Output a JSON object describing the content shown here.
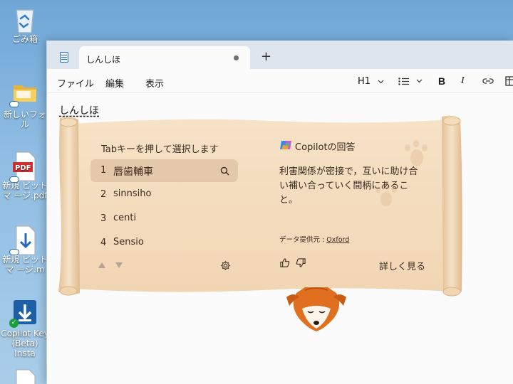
{
  "desktop": {
    "icons": [
      {
        "label": "ごみ箱",
        "icon": "recycle-bin-icon"
      },
      {
        "label": "新しいフォル",
        "icon": "folder-icon"
      },
      {
        "label": "新規 ビットマ ージ.pdf",
        "icon": "pdf-icon"
      },
      {
        "label": "新規 ビットマ ージ.m",
        "icon": "download-file-icon"
      },
      {
        "label": "Copilot Key (Beta) Insta",
        "icon": "installer-icon"
      }
    ]
  },
  "window": {
    "tab_title": "しんしほ",
    "new_tab": "+",
    "menu": [
      "ファイル",
      "編集",
      "表示"
    ],
    "toolbar": {
      "heading": "H1"
    },
    "editor_text": "しんしほ"
  },
  "ime_popup": {
    "title": "Tabキーを押して選択します",
    "candidates": [
      {
        "num": "1",
        "text": "唇歯輔車",
        "selected": true
      },
      {
        "num": "2",
        "text": "sinnsiho",
        "selected": false
      },
      {
        "num": "3",
        "text": "centi",
        "selected": false
      },
      {
        "num": "4",
        "text": "Sensio",
        "selected": false
      }
    ],
    "copilot": {
      "title": "Copilotの回答",
      "answer": "利害関係が密接で，互いに助け合い補い合っていく間柄にあること。",
      "source_label": "データ提供元 : ",
      "source_link": "Oxford",
      "more": "詳しく見る"
    }
  },
  "colors": {
    "parchment": "#f4dcbd",
    "parchment_edge": "#e8c79f",
    "ink": "#3a2a20",
    "accent": "#2f6db5"
  }
}
